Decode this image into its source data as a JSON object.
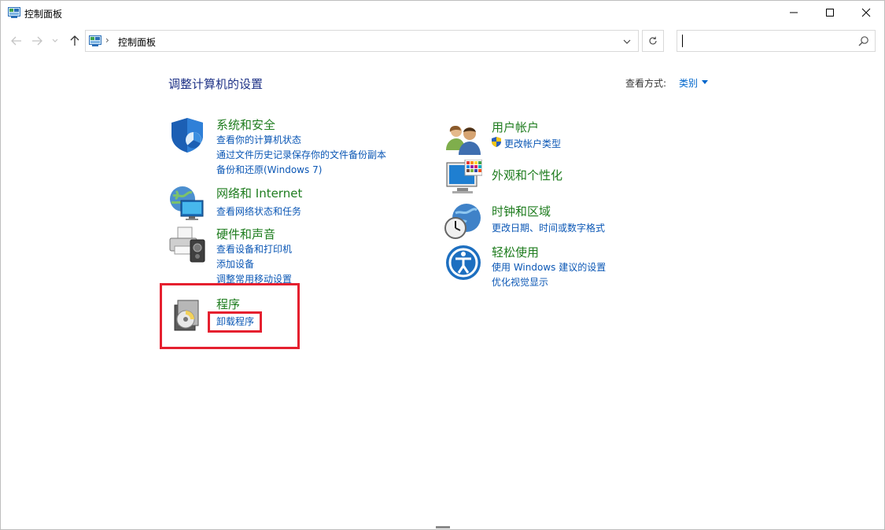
{
  "window": {
    "title": "控制面板"
  },
  "address": {
    "crumb": "控制面板",
    "separator": "›"
  },
  "search": {
    "placeholder": "",
    "value": ""
  },
  "page": {
    "title": "调整计算机的设置",
    "view_by_label": "查看方式:",
    "view_by_value": "类别"
  },
  "categories": {
    "system": {
      "title": "系统和安全",
      "links": [
        "查看你的计算机状态",
        "通过文件历史记录保存你的文件备份副本",
        "备份和还原(Windows 7)"
      ]
    },
    "network": {
      "title": "网络和 Internet",
      "links": [
        "查看网络状态和任务"
      ]
    },
    "hardware": {
      "title": "硬件和声音",
      "links": [
        "查看设备和打印机",
        "添加设备",
        "调整常用移动设置"
      ]
    },
    "programs": {
      "title": "程序",
      "links": [
        "卸载程序"
      ]
    },
    "users": {
      "title": "用户帐户",
      "links": [
        "更改帐户类型"
      ]
    },
    "appearance": {
      "title": "外观和个性化",
      "links": []
    },
    "clock": {
      "title": "时钟和区域",
      "links": [
        "更改日期、时间或数字格式"
      ]
    },
    "ease": {
      "title": "轻松使用",
      "links": [
        "使用 Windows 建议的设置",
        "优化视觉显示"
      ]
    }
  },
  "colors": {
    "category_title": "#1e7c1e",
    "link": "#0b57b5",
    "page_title": "#1e3287",
    "highlight": "#e5202f"
  },
  "icons": {
    "back": "arrow-left-icon",
    "forward": "arrow-right-icon",
    "up": "arrow-up-icon",
    "refresh": "refresh-icon",
    "search": "search-icon"
  }
}
